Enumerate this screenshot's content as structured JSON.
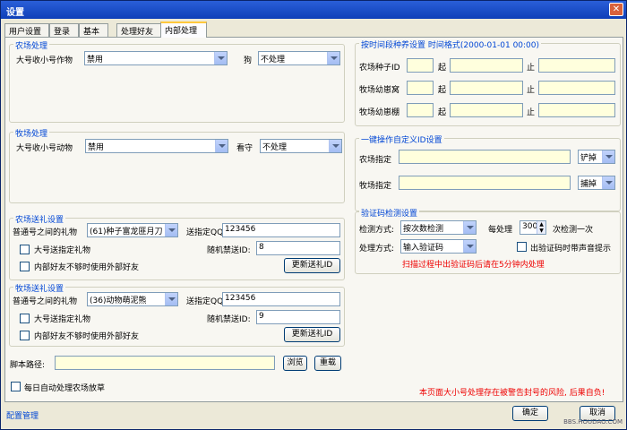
{
  "window": {
    "title": "设置",
    "close_label": "✕"
  },
  "tabs": [
    "用户设置",
    "登录",
    "基本",
    "处理好友",
    "内部处理"
  ],
  "farm": {
    "legend": "农场处理",
    "crop_label": "大号收小号作物",
    "crop_value": "禁用",
    "dog_label": "狗",
    "dog_value": "不处理"
  },
  "ranch": {
    "legend": "牧场处理",
    "animal_label": "大号收小号动物",
    "animal_value": "禁用",
    "guard_label": "看守",
    "guard_value": "不处理"
  },
  "farm_gift": {
    "legend": "农场送礼设置",
    "gift_label": "普通号之间的礼物",
    "gift_value": "(61)种子富龙匪月刀",
    "qq_label": "送指定QQ",
    "qq_value": "123456",
    "big_gift_label": "大号送指定礼物",
    "random_label": "随机禁送ID:",
    "random_value": "8",
    "external_label": "内部好友不够时使用外部好友",
    "update_button": "更新送礼ID"
  },
  "ranch_gift": {
    "legend": "牧场送礼设置",
    "gift_label": "普通号之间的礼物",
    "gift_value": "(36)动物萌泥熊",
    "qq_label": "送指定QQ",
    "qq_value": "123456",
    "big_gift_label": "大号送指定礼物",
    "random_label": "随机禁送ID:",
    "random_value": "9",
    "external_label": "内部好友不够时使用外部好友",
    "update_button": "更新送礼ID"
  },
  "script": {
    "label": "脚本路径:",
    "value": "",
    "browse_button": "浏览",
    "reload_button": "重载"
  },
  "daily": {
    "label": "每日自动处理农场放草"
  },
  "time_seed": {
    "legend": "按时间段种养设置",
    "format_hint": "时间格式(2000-01-01 00:00)",
    "rows": [
      {
        "label": "农场种子ID",
        "id": "",
        "start_label": "起",
        "start": "",
        "end_label": "止",
        "end": ""
      },
      {
        "label": "牧场幼崽窝",
        "id": "",
        "start_label": "起",
        "start": "",
        "end_label": "止",
        "end": ""
      },
      {
        "label": "牧场幼崽棚",
        "id": "",
        "start_label": "起",
        "start": "",
        "end_label": "止",
        "end": ""
      }
    ]
  },
  "oneclick": {
    "legend": "一键操作自定义ID设置",
    "farm_label": "农场指定",
    "farm_value": "",
    "farm_action": "铲掉",
    "ranch_label": "牧场指定",
    "ranch_value": "",
    "ranch_action": "捕掉"
  },
  "captcha": {
    "legend": "验证码检测设置",
    "detect_label": "检测方式:",
    "detect_value": "按次数检测",
    "every_label": "每处理",
    "every_value": "300",
    "every_suffix": "次检测一次",
    "handle_label": "处理方式:",
    "handle_value": "输入验证码",
    "sound_label": "出验证码时带声音提示",
    "notice": "扫描过程中出验证码后请在5分钟内处理"
  },
  "warning": "本页面大小号处理存在被警告封号的风险, 后果自负!",
  "footer": {
    "config_link": "配置管理",
    "ok_button": "确定",
    "cancel_button": "取消",
    "watermark": "BBS.HOUDAO.COM"
  },
  "colors": {
    "accent": "#0046d5",
    "warning": "#ee0000",
    "titlebar": "#0e3fb8"
  }
}
